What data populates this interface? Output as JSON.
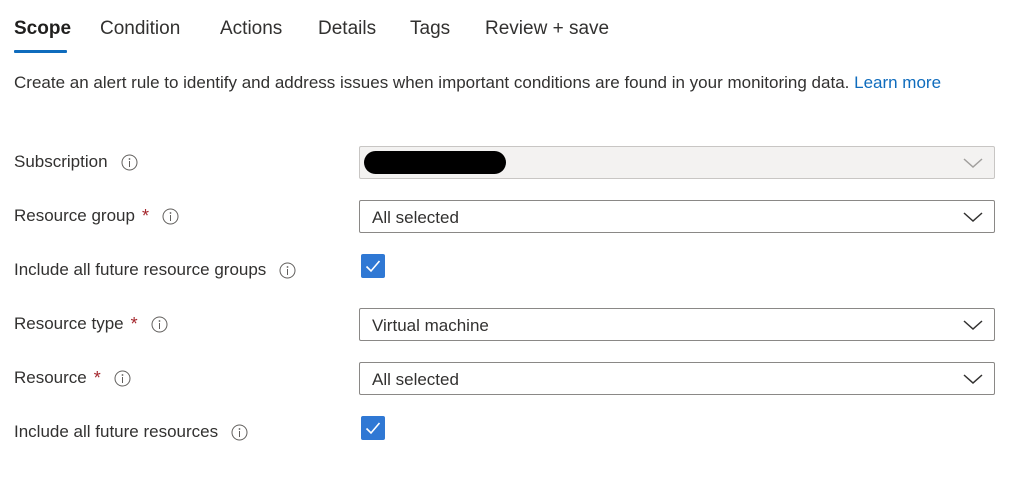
{
  "tabs": {
    "scope": "Scope",
    "condition": "Condition",
    "actions": "Actions",
    "details": "Details",
    "tags": "Tags",
    "review": "Review + save"
  },
  "description": {
    "text": "Create an alert rule to identify and address issues when important conditions are found in your monitoring data.",
    "link": "Learn more"
  },
  "form": {
    "subscription": {
      "label": "Subscription",
      "value": ""
    },
    "resource_group": {
      "label": "Resource group",
      "required_mark": "*",
      "value": "All selected"
    },
    "include_future_groups": {
      "label": "Include all future resource groups",
      "checked": true
    },
    "resource_type": {
      "label": "Resource type",
      "required_mark": "*",
      "value": "Virtual machine"
    },
    "resource": {
      "label": "Resource",
      "required_mark": "*",
      "value": "All selected"
    },
    "include_future_resources": {
      "label": "Include all future resources",
      "checked": true
    }
  },
  "colors": {
    "accent": "#0f6cbd",
    "checkbox": "#2f78d4",
    "required": "#a4262c",
    "disabled_field": "#f3f2f1"
  }
}
